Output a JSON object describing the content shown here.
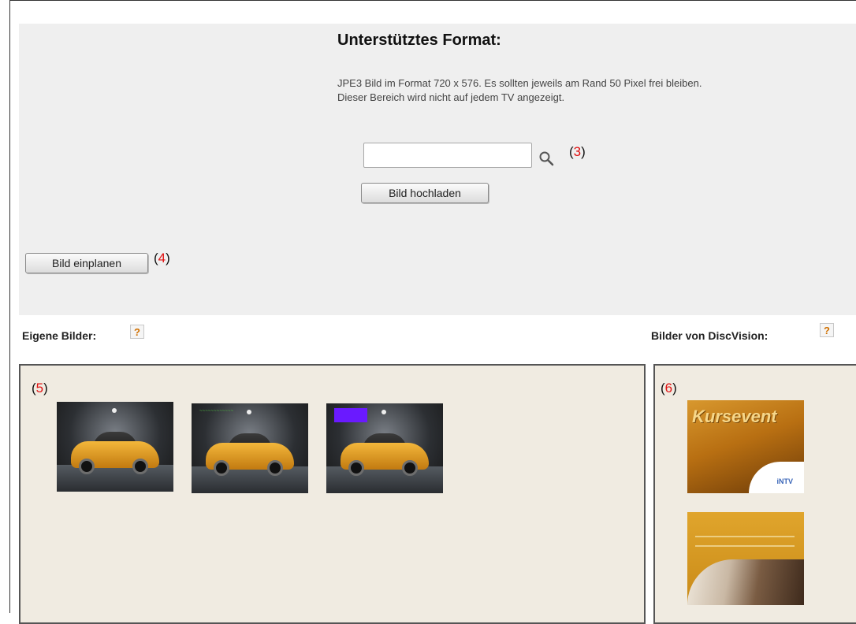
{
  "upload_section": {
    "heading": "Unterstütztes Format:",
    "description_line1": "JPE3 Bild im Format 720 x 576. Es sollten jeweils am Rand 50 Pixel frei bleiben.",
    "description_line2": "Dieser Bereich wird nicht auf jedem TV angezeigt.",
    "file_input_value": "",
    "upload_button_label": "Bild hochladen",
    "callout_3_open": "(",
    "callout_3_num": "3",
    "callout_3_close": ")"
  },
  "schedule": {
    "button_label": "Bild einplanen",
    "callout_4_open": "(",
    "callout_4_num": "4",
    "callout_4_close": ")"
  },
  "own_images": {
    "title": "Eigene Bilder:",
    "help_label": "?",
    "callout_5_open": "(",
    "callout_5_num": "5",
    "callout_5_close": ")",
    "thumbnails": [
      {
        "icon": "car-image",
        "overlay": "none"
      },
      {
        "icon": "car-image",
        "overlay": "green-text"
      },
      {
        "icon": "car-image",
        "overlay": "purple-box"
      }
    ]
  },
  "discvision_images": {
    "title": "Bilder von DiscVision:",
    "help_label": "?",
    "callout_6_open": "(",
    "callout_6_num": "6",
    "callout_6_close": ")",
    "thumbnails": [
      {
        "word": "Kursevent",
        "mini_logo": "iNTV"
      },
      {
        "icon": "promo-image"
      }
    ]
  },
  "colors": {
    "panel_bg": "#efefef",
    "gallery_bg": "#f0ebe1",
    "callout_number": "#e01010",
    "help_icon": "#d07000"
  }
}
